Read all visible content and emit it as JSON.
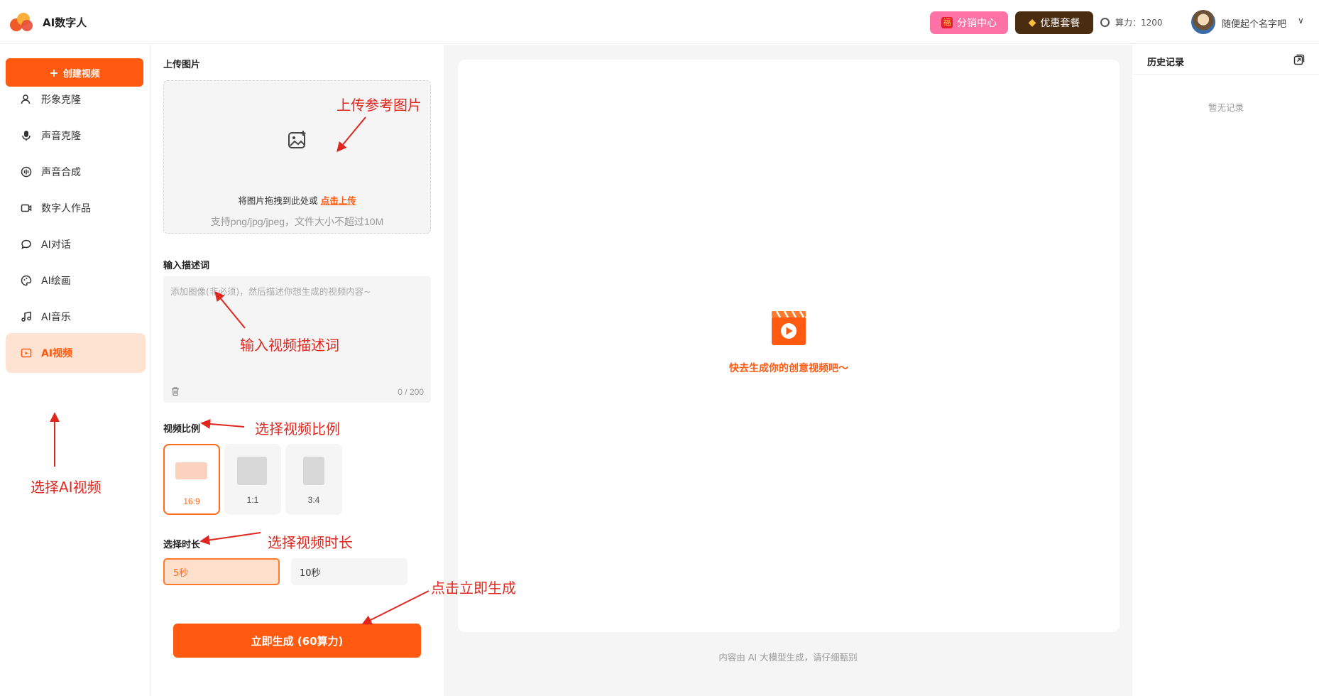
{
  "header": {
    "app_title": "AI数字人",
    "distribution_label": "分销中心",
    "package_label": "优惠套餐",
    "power_label": "算力：1200",
    "username": "随便起个名字吧",
    "chevron": "∨"
  },
  "sidebar": {
    "create_label": "创建视频",
    "items": [
      {
        "label": "形象克隆",
        "icon": "user-icon"
      },
      {
        "label": "声音克隆",
        "icon": "microphone-icon"
      },
      {
        "label": "声音合成",
        "icon": "sound-wave-icon"
      },
      {
        "label": "数字人作品",
        "icon": "video-camera-icon"
      },
      {
        "label": "AI对话",
        "icon": "chat-icon"
      },
      {
        "label": "AI绘画",
        "icon": "palette-icon"
      },
      {
        "label": "AI音乐",
        "icon": "music-note-icon"
      },
      {
        "label": "AI视频",
        "icon": "video-icon",
        "active": true
      }
    ]
  },
  "form": {
    "upload_label": "上传图片",
    "upload_hint": "将图片拖拽到此处或",
    "upload_link": "点击上传",
    "upload_sub": "支持png/jpg/jpeg，文件大小不超过10M",
    "desc_label": "输入描述词",
    "desc_placeholder": "添加图像(非必须)，然后描述你想生成的视频内容~",
    "desc_counter": "0 / 200",
    "ratio_label": "视频比例",
    "ratios": [
      {
        "label": "16:9",
        "active": true
      },
      {
        "label": "1:1",
        "active": false
      },
      {
        "label": "3:4",
        "active": false
      }
    ],
    "duration_label": "选择时长",
    "durations": [
      {
        "label": "5秒",
        "active": true
      },
      {
        "label": "10秒",
        "active": false
      }
    ],
    "generate_label": "立即生成 (60算力)"
  },
  "preview": {
    "text": "快去生成你的创意视频吧～",
    "disclaimer": "内容由 AI 大模型生成，请仔细甄别"
  },
  "history": {
    "title": "历史记录",
    "empty": "暂无记录"
  },
  "annotations": {
    "upload": "上传参考图片",
    "desc": "输入视频描述词",
    "ratio": "选择视频比例",
    "duration": "选择视频时长",
    "generate": "点击立即生成",
    "select_video": "选择AI视频"
  },
  "colors": {
    "accent": "#ff5a0f",
    "annotation": "#e0271f",
    "distribution_bg": "#ff72a5",
    "package_bg": "#4a2c10"
  }
}
